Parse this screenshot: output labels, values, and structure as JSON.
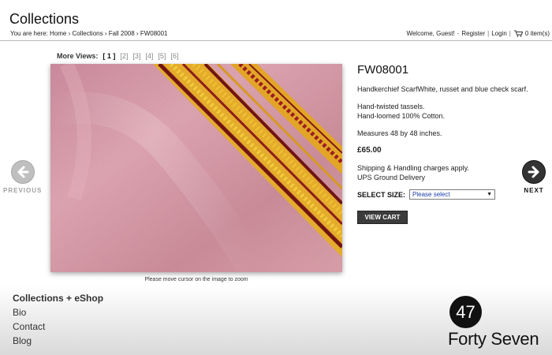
{
  "header": {
    "title": "Collections",
    "breadcrumb_prefix": "You are here:",
    "breadcrumbs": [
      "Home",
      "Collections",
      "Fall 2008",
      "FW08001"
    ],
    "welcome": "Welcome, Guest!",
    "register": "Register",
    "login": "Login",
    "cart_text": "0 item(s)"
  },
  "gallery": {
    "more_views_label": "More Views:",
    "views": [
      "[ 1 ]",
      "[2]",
      "[3]",
      "[4]",
      "[5]",
      "[6]"
    ],
    "zoom_hint": "Please move cursor on the image to zoom",
    "prev_label": "PREVIOUS",
    "next_label": "NEXT"
  },
  "product": {
    "code": "FW08001",
    "description": "Handkerchief ScarfWhite, russet and blue check scarf.",
    "feature1": "Hand-twisted tassels.",
    "feature2": "Hand-loomed 100% Cotton.",
    "measures": "Measures 48 by 48 inches.",
    "price": "£65.00",
    "shipping1": "Shipping & Handling charges apply.",
    "shipping2": "UPS Ground Delivery",
    "size_label": "SELECT SIZE:",
    "size_value": "Please select",
    "view_cart": "VIEW CART"
  },
  "footer": {
    "nav": [
      "Collections + eShop",
      "Bio",
      "Contact",
      "Blog"
    ],
    "brand_number": "47",
    "brand_name": "Forty Seven"
  },
  "colors": {
    "fabric_pink": "#d29aa6",
    "stripe_gold": "#e8b51d",
    "stripe_maroon": "#7a1515",
    "button_dark": "#3c3c3c",
    "select_text": "#1a3ea8"
  }
}
